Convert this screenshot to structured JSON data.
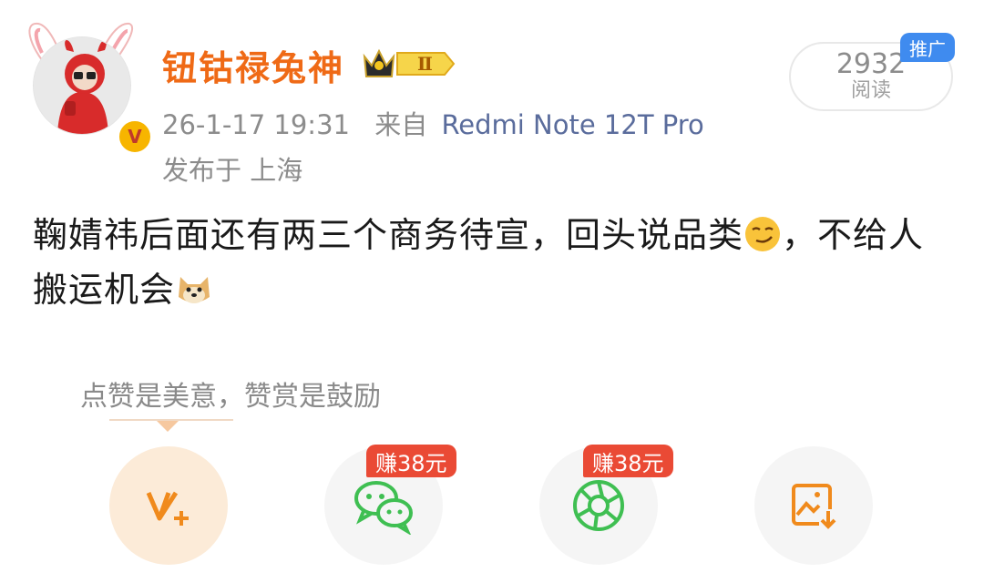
{
  "post": {
    "username": "钮钴禄兔神",
    "vip_level": "Ⅱ",
    "timestamp": "26-1-17 19:31",
    "source_prefix": "来自",
    "source_device": "Redmi Note 12T Pro",
    "location": "发布于 上海",
    "text_part1": "鞠婧祎后面还有两三个商务待宣，回头说品类",
    "text_part2": "，不给人搬运机会"
  },
  "read_counter": {
    "count": "2932",
    "label": "阅读",
    "ad_badge": "推广"
  },
  "tip": {
    "text": "点赞是美意，赞赏是鼓励"
  },
  "actions": [
    {
      "icon": "vplus-icon",
      "badge": ""
    },
    {
      "icon": "wechat-icon",
      "badge": "赚38元"
    },
    {
      "icon": "moments-icon",
      "badge": "赚38元"
    },
    {
      "icon": "save-image-icon",
      "badge": ""
    }
  ],
  "colors": {
    "username": "#ef6a16",
    "source": "#5a6c9c",
    "ad_badge": "#3f8bef",
    "earn_badge": "#ea4a35",
    "wechat_green": "#3fbf52",
    "accent_orange": "#f08a1c"
  }
}
